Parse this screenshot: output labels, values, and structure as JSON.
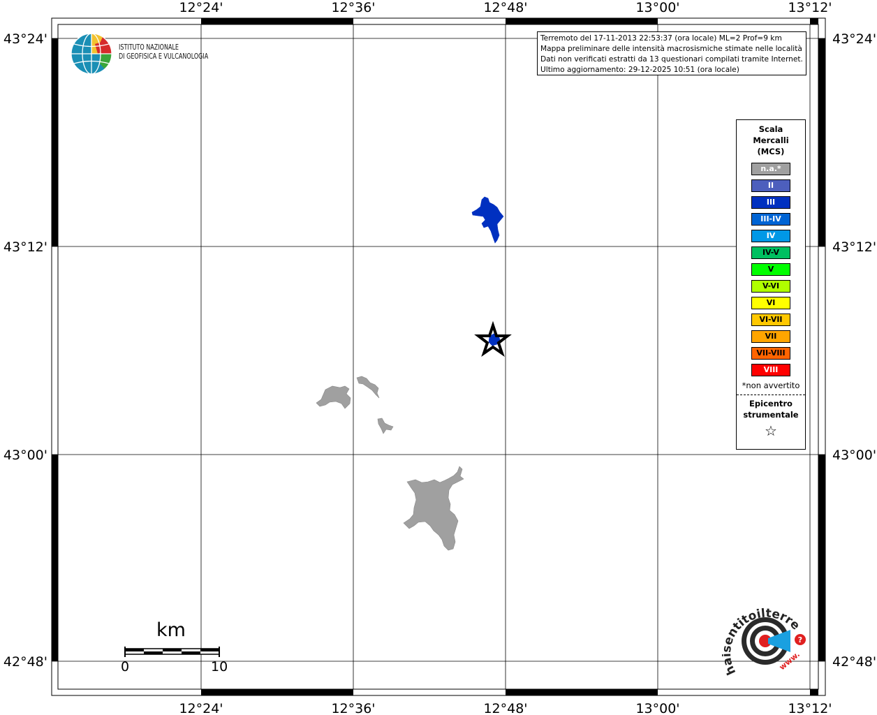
{
  "map": {
    "lon_labels": [
      "12°24'",
      "12°36'",
      "12°48'",
      "13°00'",
      "13°12'"
    ],
    "lat_labels": [
      "43°24'",
      "43°12'",
      "43°00'",
      "42°48'"
    ],
    "info_lines": [
      "Terremoto del 17-11-2013 22:53:37 (ora locale) ML=2 Prof=9 km",
      "Mappa preliminare delle intensità macrosismiche stimate nelle località",
      "Dati non verificati estratti da 13 questionari compilati tramite Internet.",
      "Ultimo aggiornamento: 29-12-2025 10:51 (ora locale)"
    ],
    "logo_ingv": {
      "line1": "ISTITUTO NAZIONALE",
      "line2": "DI GEOFISICA E VULCANOLOGIA",
      "icon": "globe-icon"
    },
    "legend": {
      "title_lines": [
        "Scala",
        "Mercalli",
        "(MCS)"
      ],
      "items": [
        {
          "label": "n.a.*",
          "color": "#a0a0a0",
          "text_color": "#ffffff"
        },
        {
          "label": "II",
          "color": "#4d5fbd",
          "text_color": "#ffffff"
        },
        {
          "label": "III",
          "color": "#0030c0",
          "text_color": "#ffffff"
        },
        {
          "label": "III-IV",
          "color": "#0064d4",
          "text_color": "#ffffff"
        },
        {
          "label": "IV",
          "color": "#0098e6",
          "text_color": "#ffffff"
        },
        {
          "label": "IV-V",
          "color": "#00c060",
          "text_color": "#000000"
        },
        {
          "label": "V",
          "color": "#00ff00",
          "text_color": "#000000"
        },
        {
          "label": "V-VI",
          "color": "#b0ff00",
          "text_color": "#000000"
        },
        {
          "label": "VI",
          "color": "#ffff00",
          "text_color": "#000000"
        },
        {
          "label": "VI-VII",
          "color": "#ffc800",
          "text_color": "#000000"
        },
        {
          "label": "VII",
          "color": "#ffa500",
          "text_color": "#000000"
        },
        {
          "label": "VII-VIII",
          "color": "#ff6400",
          "text_color": "#000000"
        },
        {
          "label": "VIII",
          "color": "#ff0000",
          "text_color": "#ffffff"
        }
      ],
      "note": "*non avvertito",
      "epicenter_lines": [
        "Epicentro",
        "strumentale"
      ],
      "epicenter_symbol": "☆"
    },
    "scale_bar": {
      "title": "km",
      "start": "0",
      "end": "10"
    },
    "hsn_logo": {
      "text": "haisentitoilterremoto.it",
      "url_text": "www.",
      "icon": "earthquake-target-icon"
    },
    "epicenter_icon": "star-icon",
    "areas": [
      {
        "name": "area-intensity-III",
        "color": "#0030c0"
      },
      {
        "name": "area-epicenter-III",
        "color": "#0030c0"
      },
      {
        "name": "area-na-west",
        "color": "#a0a0a0"
      },
      {
        "name": "area-na-center",
        "color": "#a0a0a0"
      },
      {
        "name": "area-na-small",
        "color": "#a0a0a0"
      },
      {
        "name": "area-na-south",
        "color": "#a0a0a0"
      }
    ]
  }
}
